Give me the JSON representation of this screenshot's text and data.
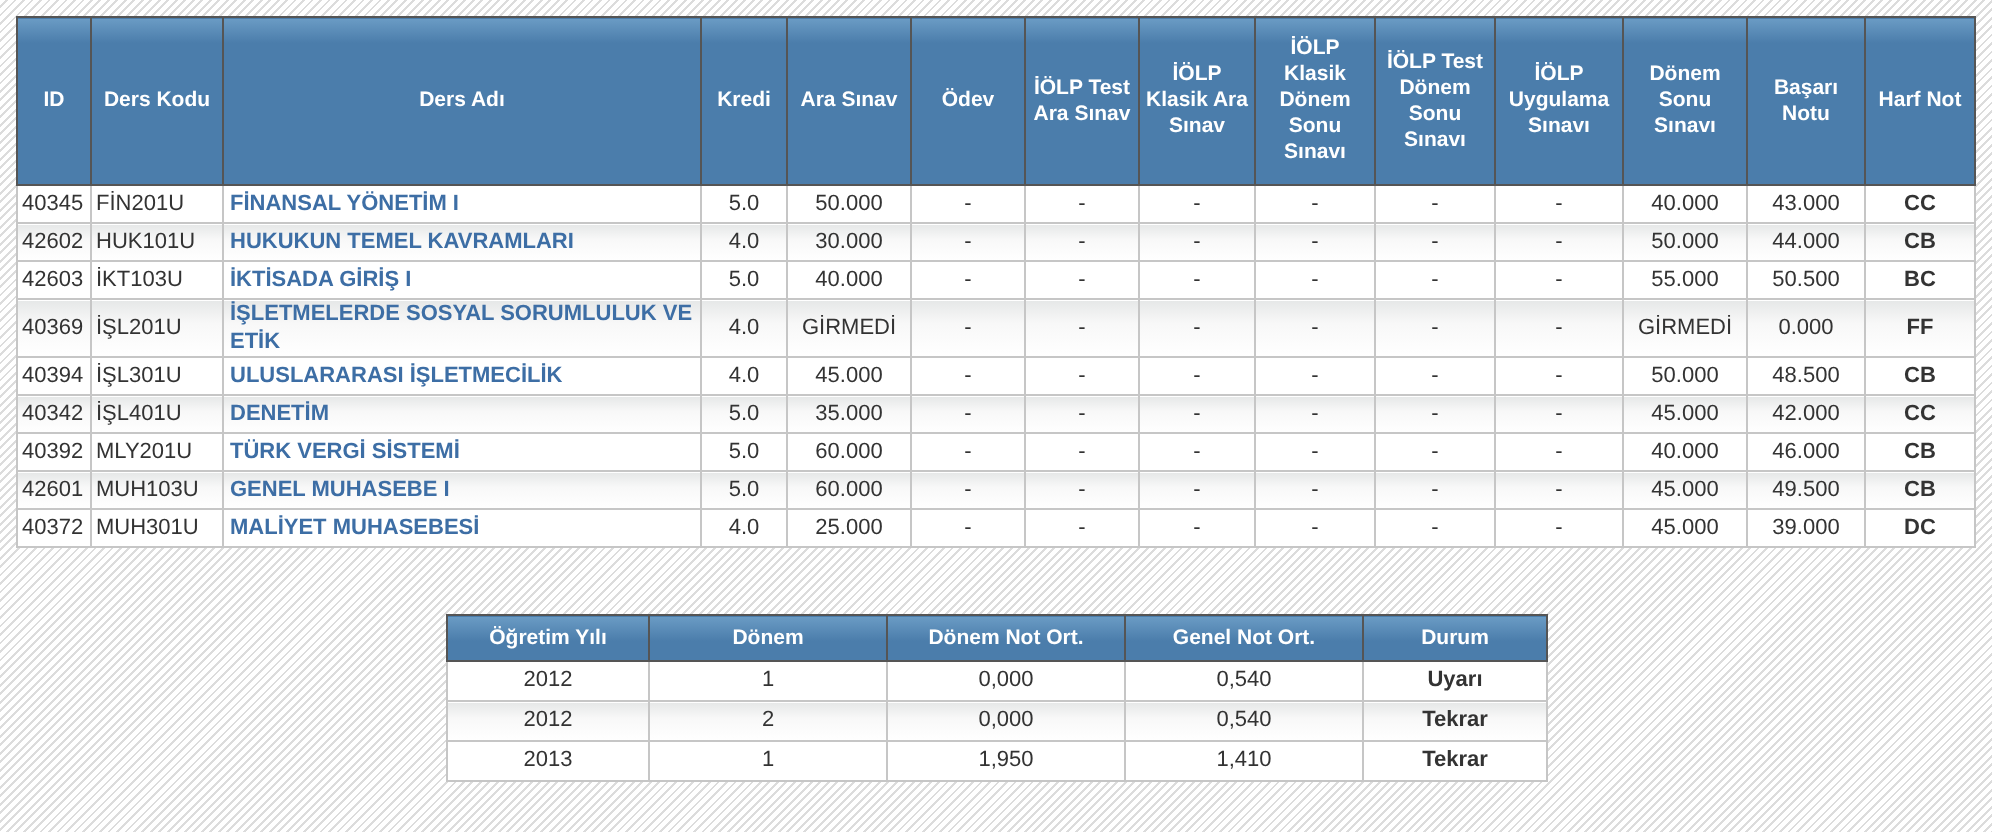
{
  "grades_table": {
    "columns": [
      {
        "label": "ID",
        "kind": "text"
      },
      {
        "label": "Ders Kodu",
        "kind": "text"
      },
      {
        "label": "Ders Adı",
        "kind": "link"
      },
      {
        "label": "Kredi",
        "kind": "num"
      },
      {
        "label": "Ara Sınav",
        "kind": "num"
      },
      {
        "label": "Ödev",
        "kind": "num"
      },
      {
        "label": "İÖLP Test Ara Sınav",
        "kind": "num"
      },
      {
        "label": "İÖLP Klasik Ara Sınav",
        "kind": "num"
      },
      {
        "label": "İÖLP Klasik Dönem Sonu Sınavı",
        "kind": "num"
      },
      {
        "label": "İÖLP Test Dönem Sonu Sınavı",
        "kind": "num"
      },
      {
        "label": "İÖLP Uygulama Sınavı",
        "kind": "num"
      },
      {
        "label": "Dönem Sonu Sınavı",
        "kind": "num"
      },
      {
        "label": "Başarı Notu",
        "kind": "num"
      },
      {
        "label": "Harf Not",
        "kind": "grade"
      }
    ],
    "rows": [
      [
        "40345",
        "FİN201U",
        "FİNANSAL YÖNETİM I",
        "5.0",
        "50.000",
        "-",
        "-",
        "-",
        "-",
        "-",
        "-",
        "40.000",
        "43.000",
        "CC"
      ],
      [
        "42602",
        "HUK101U",
        "HUKUKUN TEMEL KAVRAMLARI",
        "4.0",
        "30.000",
        "-",
        "-",
        "-",
        "-",
        "-",
        "-",
        "50.000",
        "44.000",
        "CB"
      ],
      [
        "42603",
        "İKT103U",
        "İKTİSADA GİRİŞ I",
        "5.0",
        "40.000",
        "-",
        "-",
        "-",
        "-",
        "-",
        "-",
        "55.000",
        "50.500",
        "BC"
      ],
      [
        "40369",
        "İŞL201U",
        "İŞLETMELERDE SOSYAL SORUMLULUK VE ETİK",
        "4.0",
        "GİRMEDİ",
        "-",
        "-",
        "-",
        "-",
        "-",
        "-",
        "GİRMEDİ",
        "0.000",
        "FF"
      ],
      [
        "40394",
        "İŞL301U",
        "ULUSLARARASI İŞLETMECİLİK",
        "4.0",
        "45.000",
        "-",
        "-",
        "-",
        "-",
        "-",
        "-",
        "50.000",
        "48.500",
        "CB"
      ],
      [
        "40342",
        "İŞL401U",
        "DENETİM",
        "5.0",
        "35.000",
        "-",
        "-",
        "-",
        "-",
        "-",
        "-",
        "45.000",
        "42.000",
        "CC"
      ],
      [
        "40392",
        "MLY201U",
        "TÜRK VERGİ SİSTEMİ",
        "5.0",
        "60.000",
        "-",
        "-",
        "-",
        "-",
        "-",
        "-",
        "40.000",
        "46.000",
        "CB"
      ],
      [
        "42601",
        "MUH103U",
        "GENEL MUHASEBE I",
        "5.0",
        "60.000",
        "-",
        "-",
        "-",
        "-",
        "-",
        "-",
        "45.000",
        "49.500",
        "CB"
      ],
      [
        "40372",
        "MUH301U",
        "MALİYET MUHASEBESİ",
        "4.0",
        "25.000",
        "-",
        "-",
        "-",
        "-",
        "-",
        "-",
        "45.000",
        "39.000",
        "DC"
      ]
    ]
  },
  "summary_table": {
    "columns": [
      {
        "label": "Öğretim Yılı",
        "kind": "num"
      },
      {
        "label": "Dönem",
        "kind": "num"
      },
      {
        "label": "Dönem Not Ort.",
        "kind": "num"
      },
      {
        "label": "Genel Not Ort.",
        "kind": "num"
      },
      {
        "label": "Durum",
        "kind": "grade"
      }
    ],
    "rows": [
      [
        "2012",
        "1",
        "0,000",
        "0,540",
        "Uyarı"
      ],
      [
        "2012",
        "2",
        "0,000",
        "0,540",
        "Tekrar"
      ],
      [
        "2013",
        "1",
        "1,950",
        "1,410",
        "Tekrar"
      ]
    ]
  }
}
